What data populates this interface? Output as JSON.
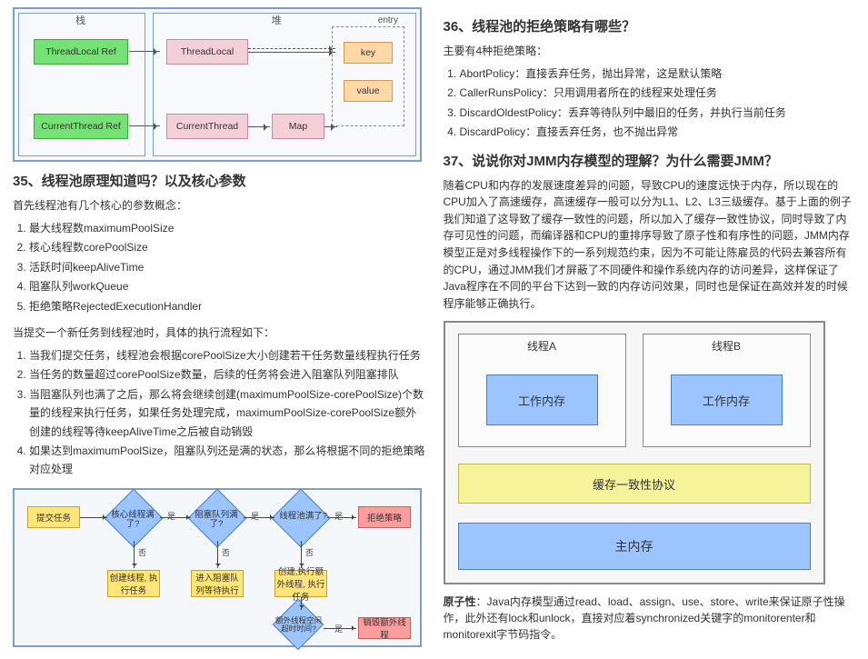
{
  "left": {
    "diagram1": {
      "panel_thread_label": "栈",
      "panel_heap_label": "堆",
      "threadlocal_ref": "ThreadLocal Ref",
      "currentthread_ref": "CurrentThread Ref",
      "threadlocal": "ThreadLocal",
      "currentthread": "CurrentThread",
      "map": "Map",
      "entry": "entry",
      "key": "key",
      "value": "value"
    },
    "h35": "35、线程池原理知道吗？以及核心参数",
    "p35a": "首先线程池有几个核心的参数概念：",
    "list35a": [
      "最大线程数maximumPoolSize",
      "核心线程数corePoolSize",
      "活跃时间keepAliveTime",
      "阻塞队列workQueue",
      "拒绝策略RejectedExecutionHandler"
    ],
    "p35b": "当提交一个新任务到线程池时，具体的执行流程如下：",
    "list35b": [
      "当我们提交任务，线程池会根据corePoolSize大小创建若干任务数量线程执行任务",
      "当任务的数量超过corePoolSize数量，后续的任务将会进入阻塞队列阻塞排队",
      "当阻塞队列也满了之后，那么将会继续创建(maximumPoolSize-corePoolSize)个数量的线程来执行任务，如果任务处理完成，maximumPoolSize-corePoolSize额外创建的线程等待keepAliveTime之后被自动销毁",
      "如果达到maximumPoolSize，阻塞队列还是满的状态，那么将根据不同的拒绝策略对应处理"
    ],
    "flow": {
      "submit": "提交任务",
      "core_full": "核心线程满了?",
      "queue_full": "阻塞队列满了?",
      "pool_full": "线程池满了?",
      "reject": "拒绝策略",
      "create_run": "创建线程, 执行任务",
      "go_queue": "进入阻塞队列等待执行",
      "create_extra": "创建,执行额外线程, 执行任务",
      "idle_timeout": "额外线程空闲超时时间?",
      "destroy": "销毁额外线程",
      "yes": "是",
      "no": "否"
    }
  },
  "right": {
    "h36": "36、线程池的拒绝策略有哪些？",
    "p36a": "主要有4种拒绝策略：",
    "list36": [
      "AbortPolicy：直接丢弃任务，抛出异常，这是默认策略",
      "CallerRunsPolicy：只用调用者所在的线程来处理任务",
      "DiscardOldestPolicy：丢弃等待队列中最旧的任务，并执行当前任务",
      "DiscardPolicy：直接丢弃任务，也不抛出异常"
    ],
    "h37": "37、说说你对JMM内存模型的理解？为什么需要JMM？",
    "p37": "随着CPU和内存的发展速度差异的问题，导致CPU的速度远快于内存，所以现在的CPU加入了高速缓存，高速缓存一般可以分为L1、L2、L3三级缓存。基于上面的例子我们知道了这导致了缓存一致性的问题，所以加入了缓存一致性协议，同时导致了内存可见性的问题，而编译器和CPU的重排序导致了原子性和有序性的问题，JMM内存模型正是对多线程操作下的一系列规范约束，因为不可能让陈雇员的代码去兼容所有的CPU，通过JMM我们才屏蔽了不同硬件和操作系统内存的访问差异，这样保证了Java程序在不同的平台下达到一致的内存访问效果，同时也是保证在高效并发的时候程序能够正确执行。",
    "jmm": {
      "thread_a": "线程A",
      "thread_b": "线程B",
      "work_mem": "工作内存",
      "cache_coh": "缓存一致性协议",
      "main_mem": "主内存"
    },
    "p_atomic_label": "原子性",
    "p_atomic": "：Java内存模型通过read、load、assign、use、store、write来保证原子性操作，此外还有lock和unlock，直接对应着synchronized关键字的monitorenter和monitorexit字节码指令。"
  }
}
